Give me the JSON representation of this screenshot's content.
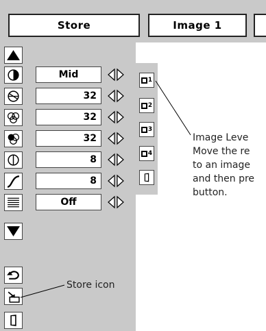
{
  "header": {
    "store_label": "Store",
    "image_label": "Image 1"
  },
  "adjustments": {
    "rows": [
      {
        "icon": "contrast-icon",
        "value": "Mid"
      },
      {
        "icon": "brightness-icon",
        "value": "32"
      },
      {
        "icon": "color-icon",
        "value": "32"
      },
      {
        "icon": "tint-icon",
        "value": "32"
      },
      {
        "icon": "sharpness-icon",
        "value": "8"
      },
      {
        "icon": "gamma-icon",
        "value": "8"
      },
      {
        "icon": "noise-reduction-icon",
        "value": "Off"
      }
    ]
  },
  "memory": {
    "slots": [
      "1",
      "2",
      "3",
      "4"
    ]
  },
  "callouts": {
    "image_level": [
      "Image Leve",
      "Move the re",
      "to an image",
      "and then pre",
      "button."
    ],
    "store_icon": "Store icon"
  },
  "colors": {
    "panel": "#c9c9c9",
    "border": "#222222"
  }
}
